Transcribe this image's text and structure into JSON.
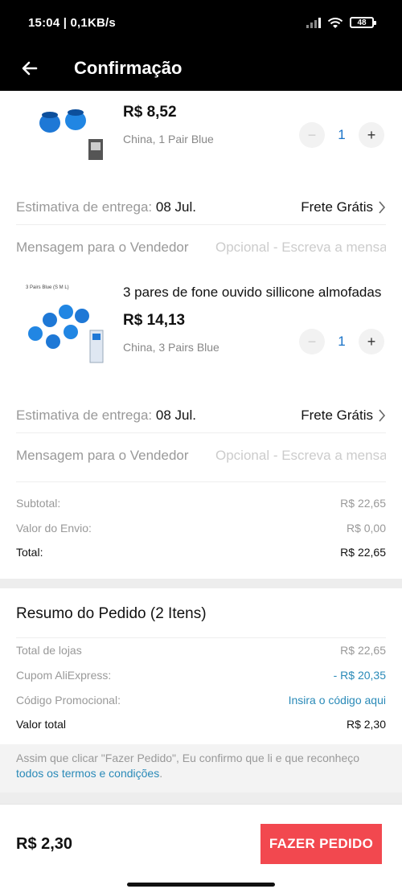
{
  "status": {
    "time": "15:04 | 0,1KB/s",
    "battery": "48"
  },
  "appbar": {
    "title": "Confirmação"
  },
  "items": [
    {
      "name": "",
      "price": "R$ 8,52",
      "variant": "China, 1 Pair Blue",
      "qty": "1",
      "delivery_label": "Estimativa de entrega:",
      "delivery_date": "08 Jul.",
      "shipping": "Frete Grátis",
      "msg_label": "Mensagem para o Vendedor",
      "msg_placeholder": "Opcional - Escreva a mensagem"
    },
    {
      "name": "3 pares de fone ouvido sillicone almofadas",
      "price": "R$ 14,13",
      "variant": "China, 3 Pairs Blue",
      "thumb_caption": "3 Pairs Blue (S M L)",
      "qty": "1",
      "delivery_label": "Estimativa de entrega:",
      "delivery_date": "08 Jul.",
      "shipping": "Frete Grátis",
      "msg_label": "Mensagem para o Vendedor",
      "msg_placeholder": "Opcional - Escreva a mensagem"
    }
  ],
  "store_summary": {
    "subtotal_label": "Subtotal:",
    "subtotal": "R$ 22,65",
    "shipping_label": "Valor do Envio:",
    "shipping": "R$ 0,00",
    "total_label": "Total:",
    "total": "R$ 22,65"
  },
  "order_summary": {
    "title": "Resumo do Pedido (2 Itens)",
    "stores_label": "Total de lojas",
    "stores": "R$ 22,65",
    "coupon_label": "Cupom AliExpress:",
    "coupon": "- R$ 20,35",
    "promo_label": "Código Promocional:",
    "promo": "Insira o código aqui",
    "total_label": "Valor total",
    "total": "R$ 2,30"
  },
  "notice": {
    "text1": "Assim que clicar \"Fazer Pedido\", Eu confirmo que li e que reconheço",
    "link": "todos os termos e condições",
    "text2": "."
  },
  "footer": {
    "total": "R$ 2,30",
    "button": "FAZER PEDIDO"
  },
  "colors": {
    "accent": "#f2484f",
    "link": "#2a8ab8",
    "product_blue": "#1e78d6"
  }
}
